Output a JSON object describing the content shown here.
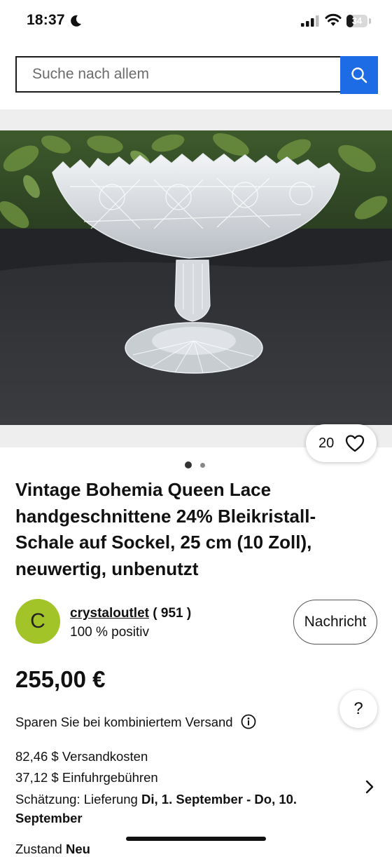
{
  "status_bar": {
    "time": "18:37",
    "battery": "34",
    "battery_level": 0.34,
    "icons": [
      "moon-icon",
      "signal-icon",
      "wifi-icon",
      "battery-icon"
    ]
  },
  "search": {
    "placeholder": "Suche nach allem",
    "button_icon": "search-icon"
  },
  "colors": {
    "accent": "#1d6ce6",
    "avatar": "#a3c429"
  },
  "gallery": {
    "watch_count": "20",
    "watch_icon": "heart-icon",
    "image_count": 2,
    "active_image": 1
  },
  "product": {
    "title": "Vintage Bohemia Queen Lace handgeschnittene 24% Bleikristall-Schale auf Sockel, 25 cm (10 Zoll), neuwertig, unbenutzt",
    "price": "255,00 €"
  },
  "seller": {
    "initial": "C",
    "name": "crystaloutlet",
    "rating": "( 951 )",
    "feedback": "100 % positiv",
    "message_label": "Nachricht"
  },
  "help": {
    "label": "?"
  },
  "shipping": {
    "combined": "Sparen Sie bei kombiniertem Versand",
    "cost": "82,46 $ Versandkosten",
    "import_fees": "37,12 $ Einfuhrgebühren",
    "estimate_label": "Schätzung: Lieferung ",
    "estimate_dates": "Di, 1. September - Do, 10. September"
  },
  "condition": {
    "label": "Zustand ",
    "value": "Neu"
  }
}
